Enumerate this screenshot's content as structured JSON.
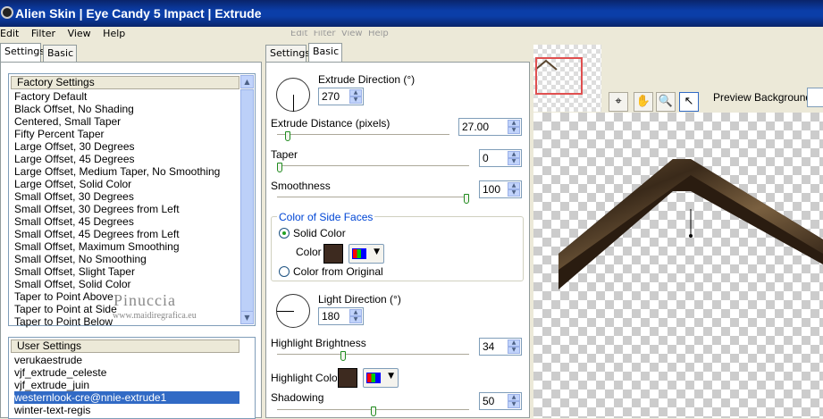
{
  "window": {
    "title": "Alien Skin  |  Eye Candy 5 Impact  |  Extrude"
  },
  "menu": {
    "items": [
      "Edit",
      "Filter",
      "View",
      "Help"
    ]
  },
  "left_tabs": {
    "settings": "Settings",
    "basic": "Basic"
  },
  "mid_tabs": {
    "settings": "Settings",
    "basic": "Basic"
  },
  "factory": {
    "header": "Factory Settings",
    "items": [
      "Factory Default",
      "Black Offset, No Shading",
      "Centered, Small Taper",
      "Fifty Percent Taper",
      "Large Offset, 30 Degrees",
      "Large Offset, 45 Degrees",
      "Large Offset, Medium Taper, No Smoothing",
      "Large Offset, Solid Color",
      "Small Offset, 30 Degrees",
      "Small Offset, 30 Degrees from Left",
      "Small Offset, 45 Degrees",
      "Small Offset, 45 Degrees from Left",
      "Small Offset, Maximum Smoothing",
      "Small Offset, No Smoothing",
      "Small Offset, Slight Taper",
      "Small Offset, Solid Color",
      "Taper to Point Above",
      "Taper to Point at Side",
      "Taper to Point Below"
    ]
  },
  "user": {
    "header": "User Settings",
    "items": [
      "verukaestrude",
      "vjf_extrude_celeste",
      "vjf_extrude_juin",
      "westernlook-cre@nnie-extrude1",
      "winter-text-regis"
    ],
    "selected": 3
  },
  "watermark": {
    "name": "Pinuccia",
    "url": "www.maidiregrafica.eu"
  },
  "controls": {
    "extrude_direction": {
      "label": "Extrude Direction (°)",
      "value": "270"
    },
    "extrude_distance": {
      "label": "Extrude Distance (pixels)",
      "value": "27.00",
      "slider": 0.05
    },
    "taper": {
      "label": "Taper",
      "value": "0",
      "slider": 0.0
    },
    "smoothness": {
      "label": "Smoothness",
      "value": "100",
      "slider": 1.0
    },
    "side_faces": {
      "title": "Color of Side Faces",
      "solid": "Solid Color",
      "color_label": "Color",
      "from_original": "Color from Original",
      "color": "#3d2a1f"
    },
    "light_direction": {
      "label": "Light Direction (°)",
      "value": "180"
    },
    "highlight_brightness": {
      "label": "Highlight Brightness",
      "value": "34",
      "slider": 0.34
    },
    "highlight_color": {
      "label": "Highlight Color",
      "color": "#3d2a1f"
    },
    "shadowing": {
      "label": "Shadowing",
      "value": "50",
      "slider": 0.5
    }
  },
  "preview": {
    "background_label": "Preview Background:"
  },
  "icons": [
    "app-icon",
    "hand-icon",
    "magnifier-icon",
    "pointer-icon",
    "navigator-icon",
    "palette-icon",
    "scroll-up-icon",
    "scroll-down-icon"
  ]
}
